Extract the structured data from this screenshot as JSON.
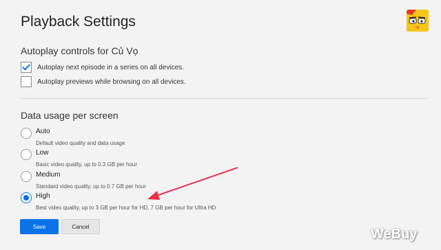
{
  "page": {
    "title": "Playback Settings"
  },
  "autoplay": {
    "heading": "Autoplay controls for Củ Vọ",
    "options": [
      {
        "label": "Autoplay next episode in a series on all devices.",
        "checked": true
      },
      {
        "label": "Autoplay previews while browsing on all devices.",
        "checked": false
      }
    ]
  },
  "data_usage": {
    "heading": "Data usage per screen",
    "options": [
      {
        "label": "Auto",
        "desc": "Default video quality and data usage",
        "selected": false
      },
      {
        "label": "Low",
        "desc": "Basic video quality, up to 0.3 GB per hour",
        "selected": false
      },
      {
        "label": "Medium",
        "desc": "Standard video quality, up to 0.7 GB per hour",
        "selected": false
      },
      {
        "label": "High",
        "desc": "Best video quality, up to 3 GB per hour for HD, 7 GB per hour for Ultra HD",
        "selected": true
      }
    ]
  },
  "buttons": {
    "save": "Save",
    "cancel": "Cancel"
  },
  "watermark": "WeBuy",
  "colors": {
    "accent": "#0071eb",
    "arrow": "#e8314a"
  }
}
